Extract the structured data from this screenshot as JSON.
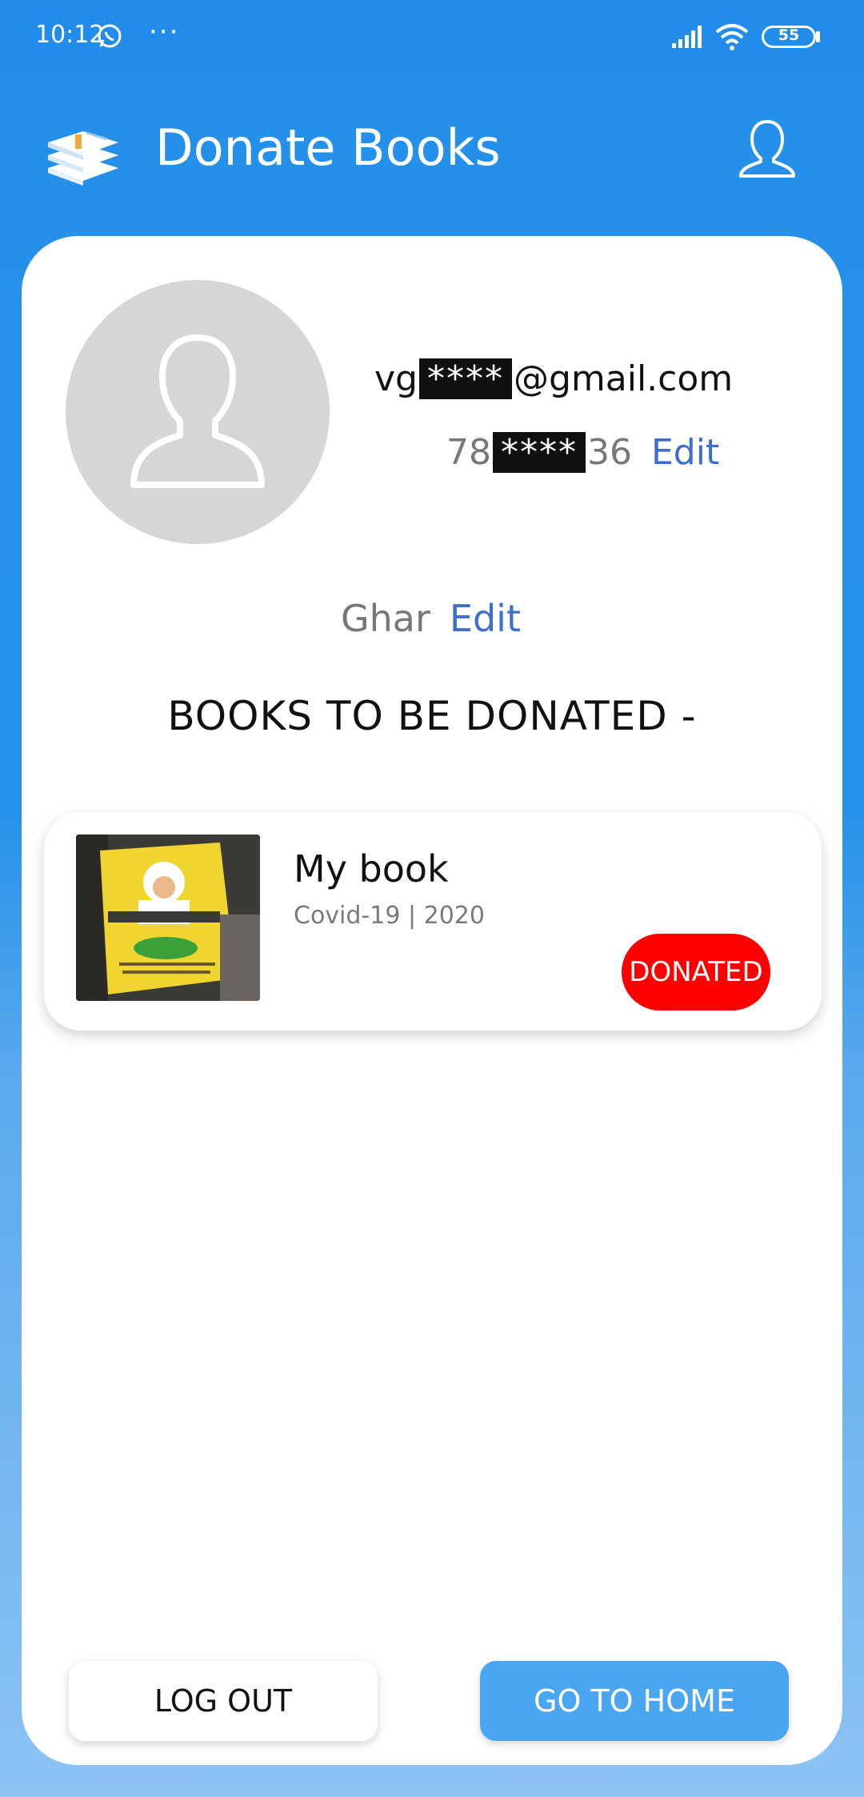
{
  "status_bar": {
    "time": "10:12",
    "overflow": "···",
    "battery": "55",
    "icons": [
      "whatsapp-icon",
      "signal-icon",
      "wifi-icon",
      "battery-icon"
    ]
  },
  "header": {
    "title": "Donate Books",
    "logo_icon": "books-stack-icon",
    "profile_icon": "user-outline-icon"
  },
  "profile": {
    "email_prefix": "vg",
    "email_redacted": "****",
    "email_suffix": "@gmail.com",
    "phone_prefix": "78",
    "phone_redacted": "****",
    "phone_suffix": "36",
    "phone_edit": "Edit",
    "address": "Ghar",
    "address_edit": "Edit"
  },
  "section_title": "BOOKS TO BE DONATED -",
  "books": [
    {
      "title": "My book",
      "subtitle": "Covid-19 | 2020",
      "status": "DONATED"
    }
  ],
  "buttons": {
    "logout": "LOG OUT",
    "home": "GO TO HOME"
  },
  "colors": {
    "primary": "#2590ea",
    "edit_link": "#3f6fc9",
    "donated_badge": "#ff0000",
    "home_button": "#4aa6f0"
  }
}
